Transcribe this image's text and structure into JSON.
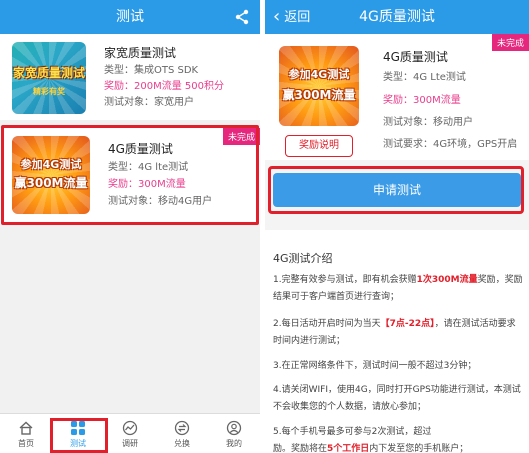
{
  "left": {
    "header": {
      "title": "测试"
    },
    "cards": [
      {
        "title": "家宽质量测试",
        "type": "类型：集成OTS SDK",
        "reward": "奖励：200M流量 500积分",
        "target": "测试对象：家宽用户",
        "thumb_line1": "家宽质量测试",
        "thumb_line2": "精彩有奖"
      },
      {
        "title": "4G质量测试",
        "type": "类型：4G lte测试",
        "reward": "奖励：300M流量",
        "target": "测试对象：移动4G用户",
        "badge": "未完成",
        "thumb_line1": "参加4G测试",
        "thumb_line2": "赢300M流量"
      }
    ],
    "tabs": [
      {
        "label": "首页",
        "icon": "home-icon"
      },
      {
        "label": "测试",
        "icon": "grid-icon"
      },
      {
        "label": "调研",
        "icon": "survey-icon"
      },
      {
        "label": "兑换",
        "icon": "exchange-icon"
      },
      {
        "label": "我的",
        "icon": "profile-icon"
      }
    ]
  },
  "right": {
    "header": {
      "back_label": "返回",
      "title": "4G质量测试"
    },
    "detail": {
      "badge": "未完成",
      "title": "4G质量测试",
      "type": "类型：4G Lte测试",
      "reward": "奖励：300M流量",
      "target": "测试对象：移动用户",
      "requirement": "测试要求：4G环境，GPS开启",
      "reward_button": "奖励说明",
      "thumb_line1": "参加4G测试",
      "thumb_line2": "赢300M流量"
    },
    "apply_button": "申请测试",
    "intro": {
      "heading": "4G测试介绍",
      "p1_a": "1.完整有效参与测试，即有机会获赠",
      "p1_em": "1次300M流量",
      "p1_b": "奖励，奖励结果可于客户端首页进行查询；",
      "p2_a": "2.每日活动开启时间为当天",
      "p2_em": "【7点-22点】",
      "p2_b": "，请在测试活动要求时间内进行测试；",
      "p3": "3.在正常网络条件下，测试时间一般不超过3分钟；",
      "p4": "4.请关闭WIFI，使用4G，同时打开GPS功能进行测试，本测试不会收集您的个人数据，请放心参加；",
      "p5_a": "5.每个手机号最多可参与2次测试，超过",
      "p5_b": "励。奖励将在",
      "p5_em": "5个工作日",
      "p5_c": "内下发至您的手机账户；"
    }
  },
  "colors": {
    "primary": "#2b9be8",
    "badge": "#e5287e",
    "highlight": "#e2202b",
    "reward_text": "#e83e8c"
  }
}
